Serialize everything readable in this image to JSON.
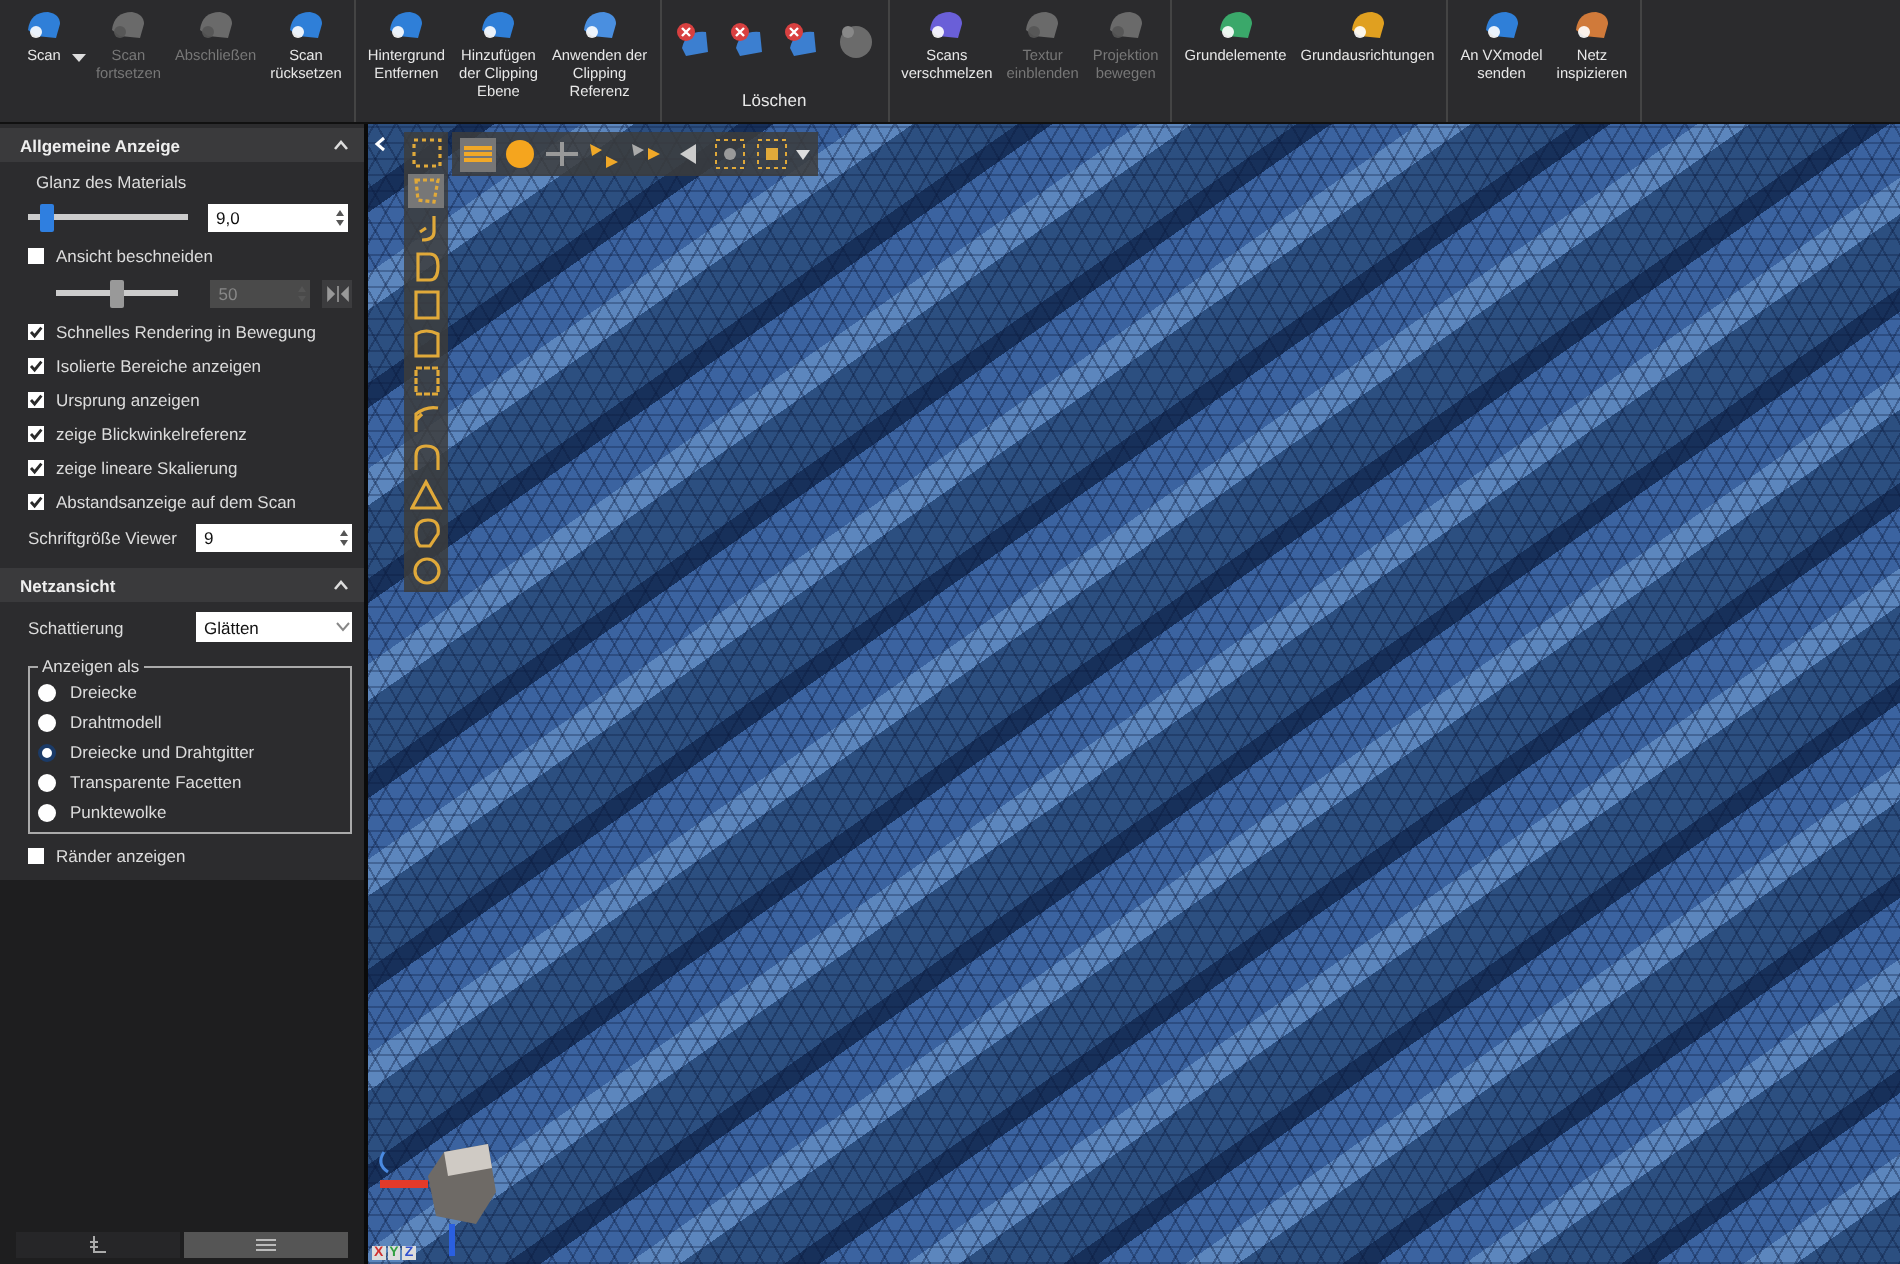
{
  "ribbon": {
    "groups": [
      {
        "items": [
          {
            "kind": "button",
            "label": "Scan",
            "disabled": false,
            "dropdown": true
          },
          {
            "kind": "button",
            "label": "Scan\nfortsetzen",
            "disabled": true,
            "dropdown": false
          },
          {
            "kind": "button",
            "label": "Abschließen",
            "disabled": true,
            "dropdown": false
          },
          {
            "kind": "button",
            "label": "Scan\nrücksetzen",
            "disabled": false,
            "dropdown": false
          }
        ]
      },
      {
        "items": [
          {
            "kind": "button",
            "label": "Hintergrund\nEntfernen",
            "disabled": false,
            "dropdown": false
          },
          {
            "kind": "button",
            "label": "Hinzufügen\nder Clipping\nEbene",
            "disabled": false,
            "dropdown": false
          },
          {
            "kind": "button",
            "label": "Anwenden der\nClipping\nReferenz",
            "disabled": false,
            "dropdown": false
          }
        ]
      },
      {
        "label": "Löschen",
        "items": [
          {
            "kind": "icon",
            "disabled": false
          },
          {
            "kind": "icon",
            "disabled": false
          },
          {
            "kind": "icon",
            "disabled": false
          },
          {
            "kind": "icon",
            "disabled": true
          }
        ]
      },
      {
        "items": [
          {
            "kind": "button",
            "label": "Scans\nverschmelzen",
            "disabled": false,
            "dropdown": false
          },
          {
            "kind": "button",
            "label": "Textur\neinblenden",
            "disabled": true,
            "dropdown": false
          },
          {
            "kind": "button",
            "label": "Projektion\nbewegen",
            "disabled": true,
            "dropdown": false
          }
        ]
      },
      {
        "items": [
          {
            "kind": "button",
            "label": "Grundelemente",
            "disabled": false,
            "dropdown": false
          },
          {
            "kind": "button",
            "label": "Grundausrichtungen",
            "disabled": false,
            "dropdown": false
          }
        ]
      },
      {
        "items": [
          {
            "kind": "button",
            "label": "An VXmodel\nsenden",
            "disabled": false,
            "dropdown": false
          },
          {
            "kind": "button",
            "label": "Netz\ninspizieren",
            "disabled": false,
            "dropdown": false
          }
        ]
      }
    ]
  },
  "sidebar": {
    "sections": [
      {
        "title": "Allgemeine Anzeige",
        "expanded": true,
        "controls": [
          {
            "kind": "label",
            "text": "Glanz des Materials"
          },
          {
            "kind": "slider",
            "level": 0.08,
            "value": "9,0",
            "disabled": false,
            "flip": false
          },
          {
            "kind": "checkbox",
            "label": "Ansicht beschneiden",
            "checked": false
          },
          {
            "kind": "slider",
            "level": 0.5,
            "value": "50",
            "disabled": true,
            "flip": true
          },
          {
            "kind": "checkbox",
            "label": "Schnelles Rendering in Bewegung",
            "checked": true
          },
          {
            "kind": "checkbox",
            "label": "Isolierte Bereiche anzeigen",
            "checked": true
          },
          {
            "kind": "checkbox",
            "label": "Ursprung anzeigen",
            "checked": true
          },
          {
            "kind": "checkbox",
            "label": "zeige Blickwinkelreferenz",
            "checked": true
          },
          {
            "kind": "checkbox",
            "label": "zeige lineare Skalierung",
            "checked": true
          },
          {
            "kind": "checkbox",
            "label": "Abstandsanzeige auf dem Scan",
            "checked": true
          },
          {
            "kind": "spin",
            "label": "Schriftgröße Viewer",
            "value": "9"
          }
        ]
      },
      {
        "title": "Netzansicht",
        "expanded": true,
        "controls": [
          {
            "kind": "dropdown",
            "label": "Schattierung",
            "value": "Glätten"
          },
          {
            "kind": "radio_group",
            "title": "Anzeigen als",
            "options": [
              {
                "label": "Dreiecke",
                "selected": false
              },
              {
                "label": "Drahtmodell",
                "selected": false
              },
              {
                "label": "Dreiecke und Drahtgitter",
                "selected": true
              },
              {
                "label": "Transparente Facetten",
                "selected": false
              },
              {
                "label": "Punktewolke",
                "selected": false
              }
            ]
          },
          {
            "kind": "checkbox",
            "label": "Ränder anzeigen",
            "checked": false
          }
        ]
      }
    ],
    "bottom_tabs": [
      {
        "selected": false
      },
      {
        "selected": true
      }
    ]
  },
  "viewport": {
    "side_tools": [
      {
        "selected": false
      },
      {
        "selected": true
      },
      {
        "selected": false
      },
      {
        "selected": false
      },
      {
        "selected": false
      },
      {
        "selected": false
      },
      {
        "selected": false
      },
      {
        "selected": false
      },
      {
        "selected": false
      },
      {
        "selected": false
      },
      {
        "selected": false
      },
      {
        "selected": false
      }
    ],
    "top_tools": [
      {
        "selected": true
      },
      {
        "selected": false
      },
      {
        "selected": false
      },
      {
        "selected": false
      },
      {
        "selected": false
      },
      {
        "selected": false
      },
      {
        "selected": false
      },
      {
        "selected": false
      }
    ],
    "axis_labels": [
      "X",
      "Y",
      "Z"
    ]
  }
}
